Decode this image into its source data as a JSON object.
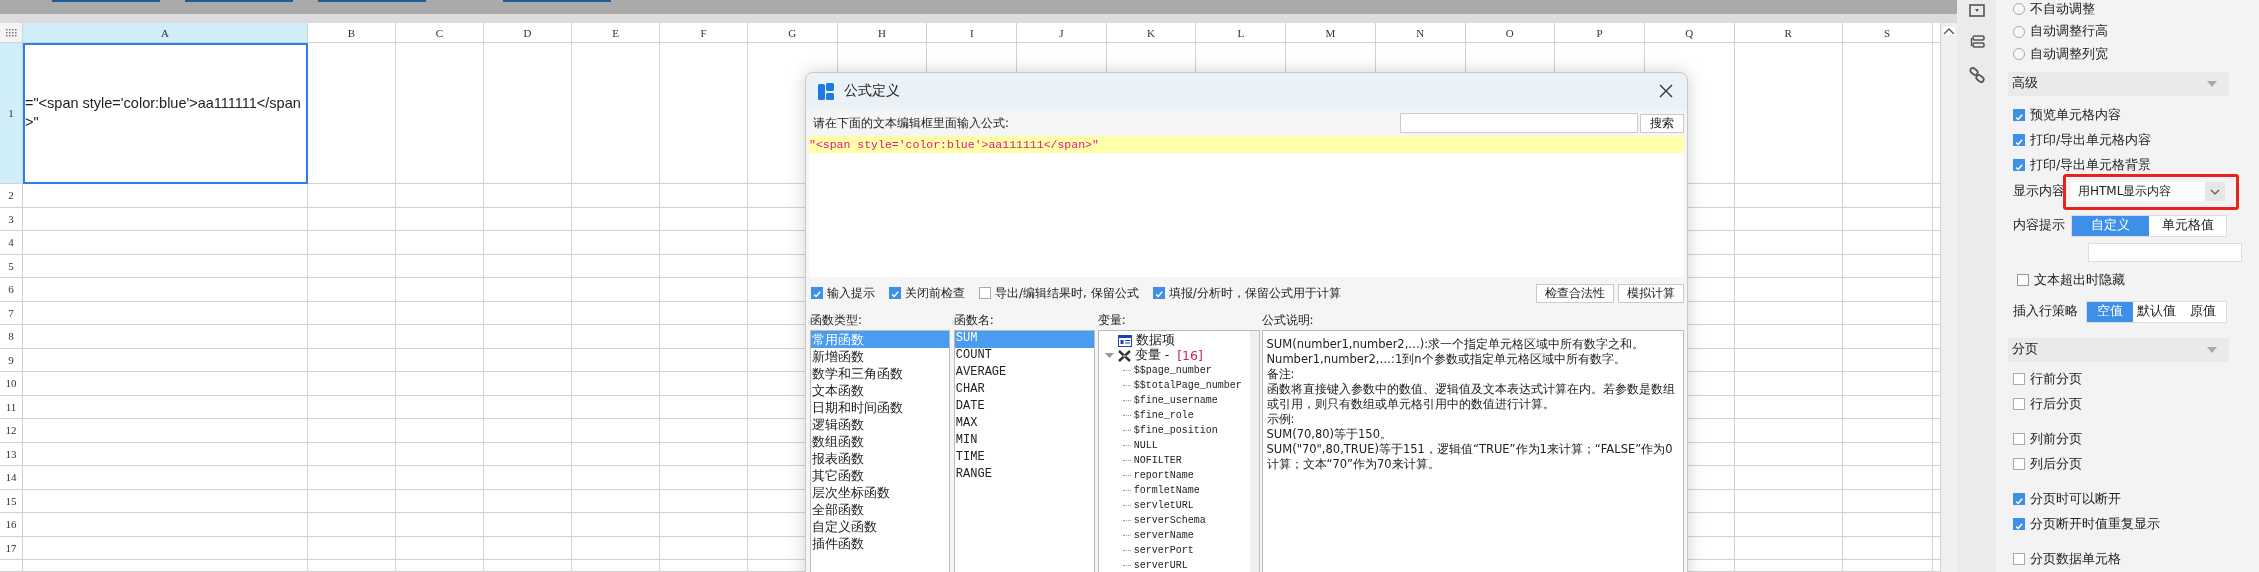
{
  "sheet": {
    "columns": [
      {
        "label": "A",
        "selected": true
      },
      {
        "label": "B",
        "selected": false
      },
      {
        "label": "C",
        "selected": false
      },
      {
        "label": "D",
        "selected": false
      },
      {
        "label": "E",
        "selected": false
      },
      {
        "label": "F",
        "selected": false
      },
      {
        "label": "G",
        "selected": false
      },
      {
        "label": "H",
        "selected": false
      },
      {
        "label": "I",
        "selected": false
      },
      {
        "label": "J",
        "selected": false
      },
      {
        "label": "K",
        "selected": false
      },
      {
        "label": "L",
        "selected": false
      },
      {
        "label": "M",
        "selected": false
      },
      {
        "label": "N",
        "selected": false
      },
      {
        "label": "O",
        "selected": false
      },
      {
        "label": "P",
        "selected": false
      },
      {
        "label": "Q",
        "selected": false
      },
      {
        "label": "R",
        "selected": false
      },
      {
        "label": "S",
        "selected": false
      }
    ],
    "rows": [
      {
        "label": "1",
        "selected": true
      },
      {
        "label": "2",
        "selected": false
      },
      {
        "label": "3",
        "selected": false
      },
      {
        "label": "4",
        "selected": false
      },
      {
        "label": "5",
        "selected": false
      },
      {
        "label": "6",
        "selected": false
      },
      {
        "label": "7",
        "selected": false
      },
      {
        "label": "8",
        "selected": false
      },
      {
        "label": "9",
        "selected": false
      },
      {
        "label": "10",
        "selected": false
      },
      {
        "label": "11",
        "selected": false
      },
      {
        "label": "12",
        "selected": false
      },
      {
        "label": "13",
        "selected": false
      },
      {
        "label": "14",
        "selected": false
      },
      {
        "label": "15",
        "selected": false
      },
      {
        "label": "16",
        "selected": false
      },
      {
        "label": "17",
        "selected": false
      }
    ],
    "cell_a1": {
      "value": "=\"<span style='color:blue'>aa111111</span>\"",
      "selected": true
    }
  },
  "dialog": {
    "title": "公式定义",
    "prompt": "请在下面的文本编辑框里面输入公式:",
    "search_button": "搜索",
    "formula": "\"<span style='color:blue'>aa111111</span>\"",
    "options": [
      {
        "label": "输入提示",
        "checked": true
      },
      {
        "label": "关闭前检查",
        "checked": true
      },
      {
        "label": "导出/编辑结果时, 保留公式",
        "checked": false
      },
      {
        "label": "填报/分析时，保留公式用于计算",
        "checked": true
      }
    ],
    "buttons": [
      "检查合法性",
      "模拟计算"
    ],
    "function_types": {
      "label": "函数类型:",
      "items": [
        {
          "label": "常用函数",
          "selected": true
        },
        {
          "label": "新增函数",
          "selected": false
        },
        {
          "label": "数学和三角函数",
          "selected": false
        },
        {
          "label": "文本函数",
          "selected": false
        },
        {
          "label": "日期和时间函数",
          "selected": false
        },
        {
          "label": "逻辑函数",
          "selected": false
        },
        {
          "label": "数组函数",
          "selected": false
        },
        {
          "label": "报表函数",
          "selected": false
        },
        {
          "label": "其它函数",
          "selected": false
        },
        {
          "label": "层次坐标函数",
          "selected": false
        },
        {
          "label": "全部函数",
          "selected": false
        },
        {
          "label": "自定义函数",
          "selected": false
        },
        {
          "label": "插件函数",
          "selected": false
        }
      ]
    },
    "function_names": {
      "label": "函数名:",
      "items": [
        {
          "label": "SUM",
          "selected": true
        },
        {
          "label": "COUNT",
          "selected": false
        },
        {
          "label": "AVERAGE",
          "selected": false
        },
        {
          "label": "CHAR",
          "selected": false
        },
        {
          "label": "DATE",
          "selected": false
        },
        {
          "label": "MAX",
          "selected": false
        },
        {
          "label": "MIN",
          "selected": false
        },
        {
          "label": "TIME",
          "selected": false
        },
        {
          "label": "RANGE",
          "selected": false
        }
      ]
    },
    "variables": {
      "label": "变量:",
      "tree": [
        {
          "label": "数据项",
          "kind": "data"
        },
        {
          "label": "变量 - ",
          "count": "[16]",
          "kind": "variables",
          "expanded": true,
          "children": [
            "$$page_number",
            "$$totalPage_number",
            "$fine_username",
            "$fine_role",
            "$fine_position",
            "NULL",
            "NOFILTER",
            "reportName",
            "formletName",
            "servletURL",
            "serverSchema",
            "serverName",
            "serverPort",
            "serverURL"
          ]
        }
      ]
    },
    "description": {
      "label": "公式说明:",
      "lines": [
        "SUM(number1,number2,…):求一个指定单元格区域中所有数字之和。",
        "Number1,number2,…:1到n个参数或指定单元格区域中所有数字。",
        "备注:",
        "函数将直接键入参数中的数值、逻辑值及文本表达式计算在内。若参数是数组或引用，则只有数组或单元格引用中的数值进行计算。",
        "示例:",
        "SUM(70,80)等于150。",
        "SUM(\"70\",80,TRUE)等于151，逻辑值“TRUE”作为1来计算；“FALSE”作为0计算；文本“70”作为70来计算。"
      ]
    }
  },
  "panel": {
    "autofit": [
      {
        "label": "不自动调整",
        "selected": false
      },
      {
        "label": "自动调整行高",
        "selected": false
      },
      {
        "label": "自动调整列宽",
        "selected": false
      }
    ],
    "advanced": {
      "title": "高级",
      "options": [
        {
          "label": "预览单元格内容",
          "checked": true
        },
        {
          "label": "打印/导出单元格内容",
          "checked": true
        },
        {
          "label": "打印/导出单元格背景",
          "checked": true
        }
      ],
      "display": {
        "label": "显示内容",
        "value": "用HTML显示内容",
        "highlighted": true
      },
      "tooltip": {
        "label": "内容提示",
        "choices": [
          {
            "label": "自定义",
            "selected": true
          },
          {
            "label": "单元格值",
            "selected": false
          }
        ]
      },
      "hide_overflow": {
        "label": "文本超出时隐藏",
        "checked": false
      },
      "insert_policy": {
        "label": "插入行策略",
        "choices": [
          {
            "label": "空值",
            "selected": true
          },
          {
            "label": "默认值",
            "selected": false
          },
          {
            "label": "原值",
            "selected": false
          }
        ]
      }
    },
    "pagination": {
      "title": "分页",
      "groups": [
        [
          {
            "label": "行前分页",
            "checked": false
          },
          {
            "label": "行后分页",
            "checked": false
          }
        ],
        [
          {
            "label": "列前分页",
            "checked": false
          },
          {
            "label": "列后分页",
            "checked": false
          }
        ],
        [
          {
            "label": "分页时可以断开",
            "checked": true
          },
          {
            "label": "分页断开时值重复显示",
            "checked": true
          }
        ],
        [
          {
            "label": "分页数据单元格",
            "checked": false
          }
        ]
      ]
    }
  }
}
